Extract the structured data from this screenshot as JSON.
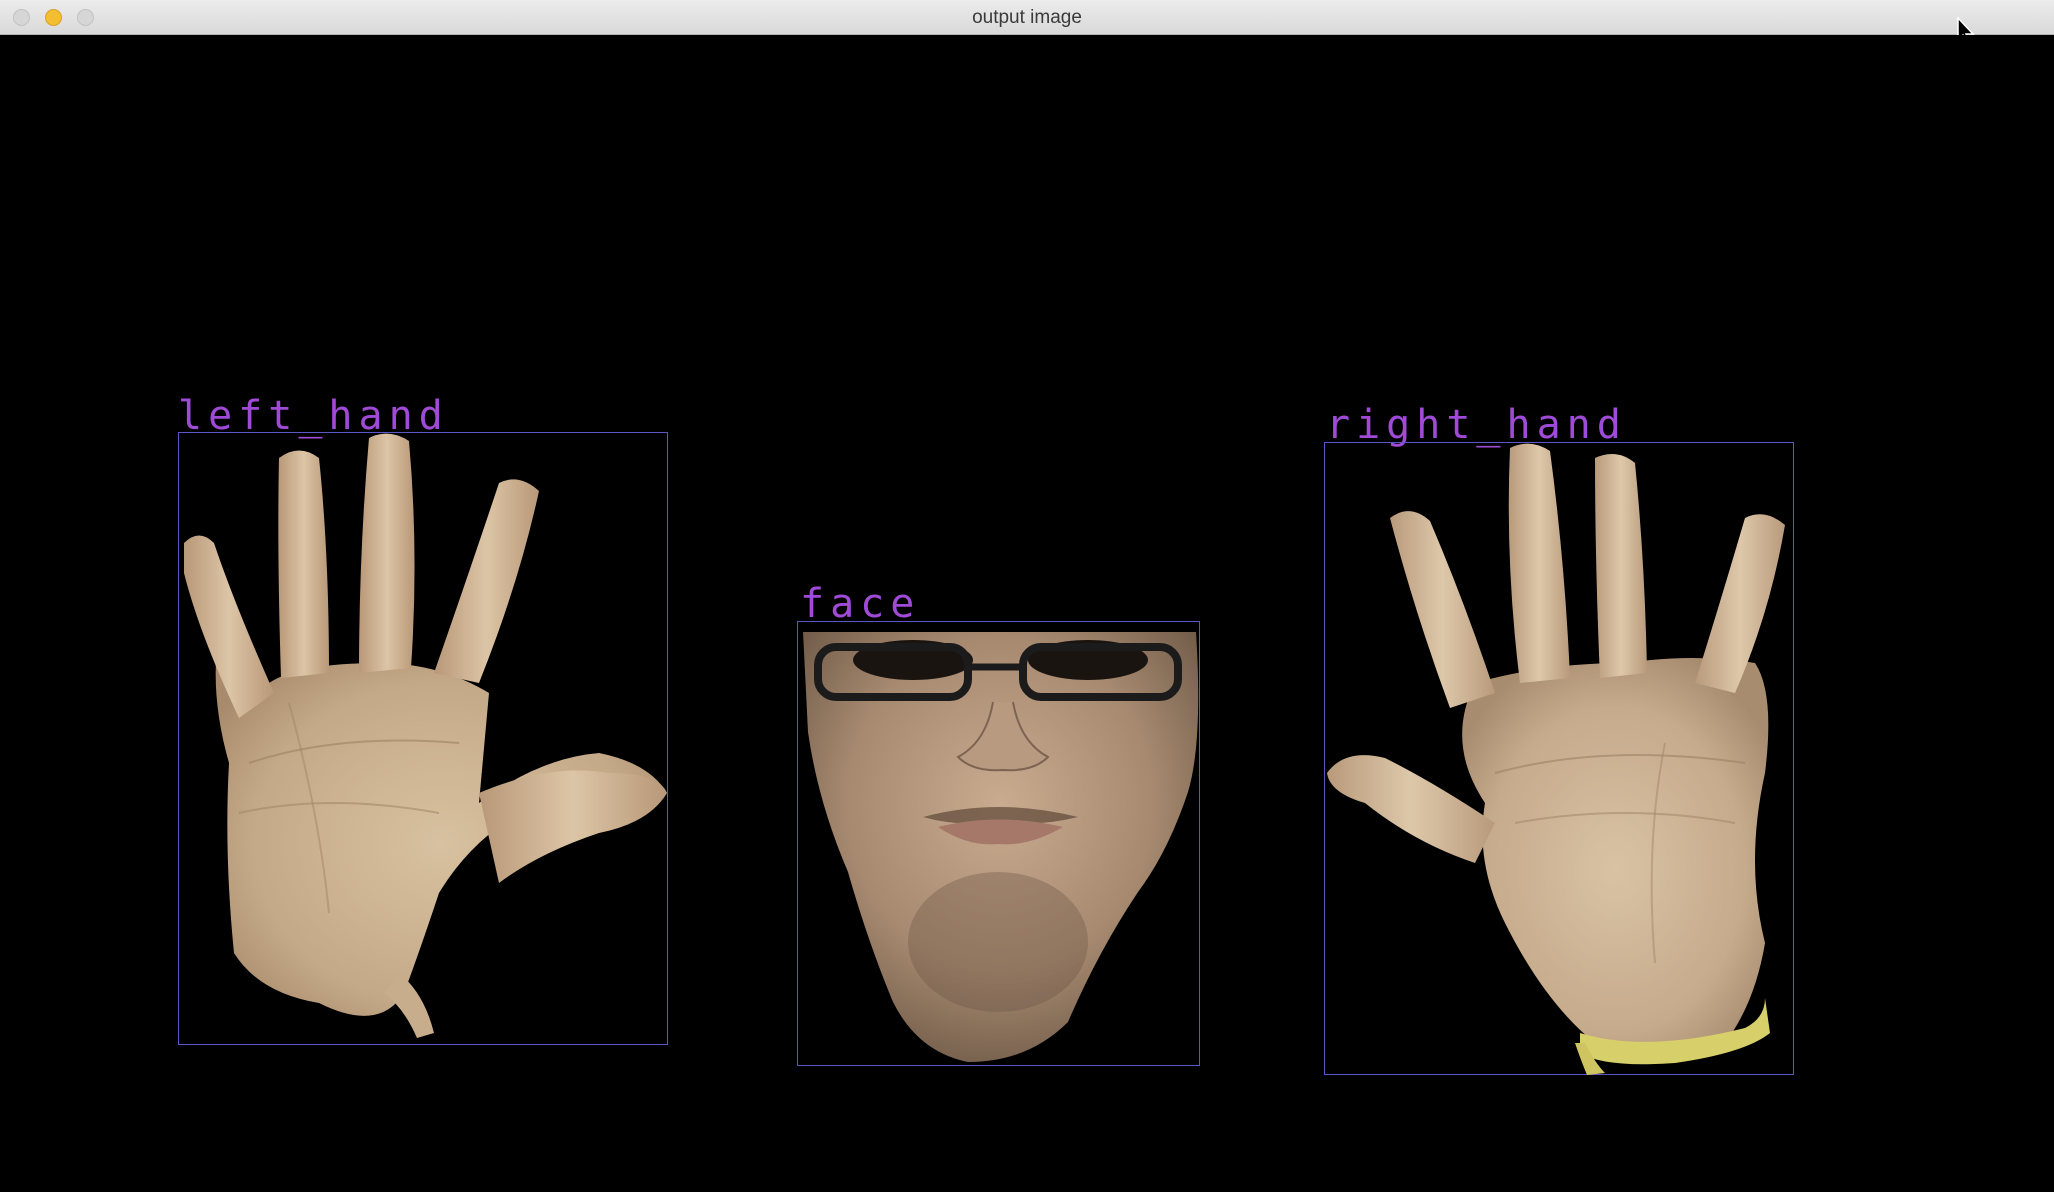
{
  "window": {
    "title": "output image"
  },
  "colors": {
    "box_border": "#5a58c8",
    "label_text": "#a04ad8",
    "background": "#000000"
  },
  "detections": {
    "left_hand": {
      "label": "left_hand"
    },
    "face": {
      "label": "face"
    },
    "right_hand": {
      "label": "right_hand"
    }
  },
  "icons": {
    "close": "close-icon",
    "minimize": "minimize-icon",
    "zoom": "zoom-icon",
    "cursor": "arrow-cursor-icon"
  }
}
